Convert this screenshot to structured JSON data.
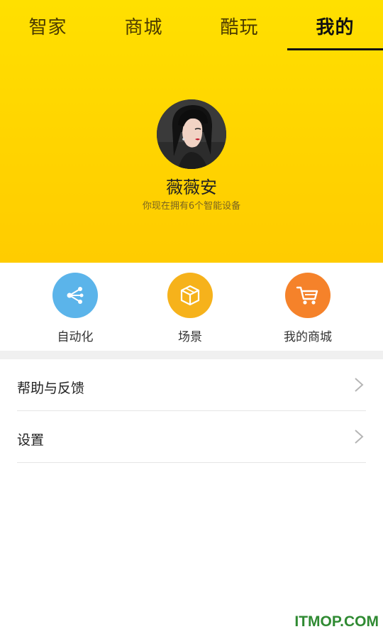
{
  "tabs": [
    {
      "label": "智家"
    },
    {
      "label": "商城"
    },
    {
      "label": "酷玩"
    },
    {
      "label": "我的"
    }
  ],
  "active_tab_index": 3,
  "profile": {
    "username": "薇薇安",
    "device_info": "你现在拥有6个智能设备"
  },
  "actions": [
    {
      "label": "自动化",
      "icon": "share-nodes-icon",
      "color": "#5bb4ea"
    },
    {
      "label": "场景",
      "icon": "cube-icon",
      "color": "#f6b21b"
    },
    {
      "label": "我的商城",
      "icon": "cart-icon",
      "color": "#f5822a"
    }
  ],
  "menu": [
    {
      "label": "帮助与反馈",
      "icon": "chevron-right-icon"
    },
    {
      "label": "设置",
      "icon": "chevron-right-icon"
    }
  ],
  "watermark": "ITMOP.COM",
  "colors": {
    "header_yellow": "#ffd800",
    "accent_blue": "#5bb4ea",
    "accent_yellow": "#f6b21b",
    "accent_orange": "#f5822a"
  }
}
